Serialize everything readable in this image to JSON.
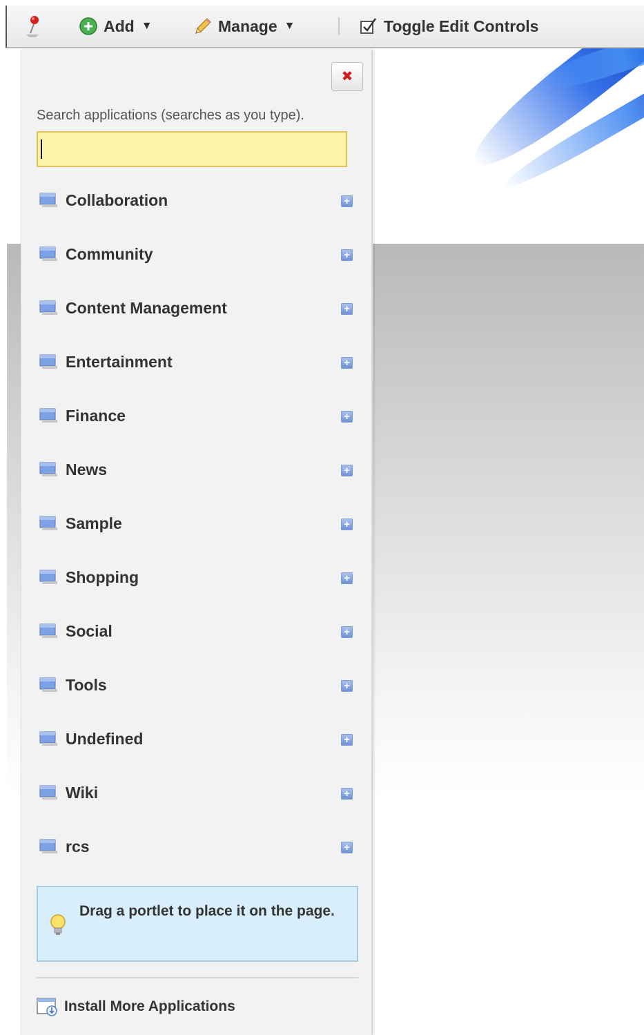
{
  "toolbar": {
    "add_label": "Add",
    "manage_label": "Manage",
    "toggle_label": "Toggle Edit Controls",
    "caret": "▼"
  },
  "panel": {
    "close_symbol": "✖",
    "search_label": "Search applications (searches as you type).",
    "search_value": "",
    "categories": [
      {
        "label": "Collaboration"
      },
      {
        "label": "Community"
      },
      {
        "label": "Content Management"
      },
      {
        "label": "Entertainment"
      },
      {
        "label": "Finance"
      },
      {
        "label": "News"
      },
      {
        "label": "Sample"
      },
      {
        "label": "Shopping"
      },
      {
        "label": "Social"
      },
      {
        "label": "Tools"
      },
      {
        "label": "Undefined"
      },
      {
        "label": "Wiki"
      },
      {
        "label": "rcs"
      }
    ],
    "expand_symbol": "+",
    "tip": "Drag a portlet to place it on the page.",
    "install_label": "Install More Applications"
  },
  "colors": {
    "search_bg": "#fbf3a6",
    "tip_bg": "#d8eefb",
    "accent_blue": "#6f92d6",
    "close_red": "#cc2020"
  },
  "icons": {
    "toolbar": [
      "pin-icon",
      "add-plus-icon",
      "pencil-icon",
      "checkbox-icon"
    ],
    "category": "folder-icon",
    "expand": "plus-square-icon",
    "tip": "lightbulb-icon",
    "install": "install-app-icon"
  }
}
